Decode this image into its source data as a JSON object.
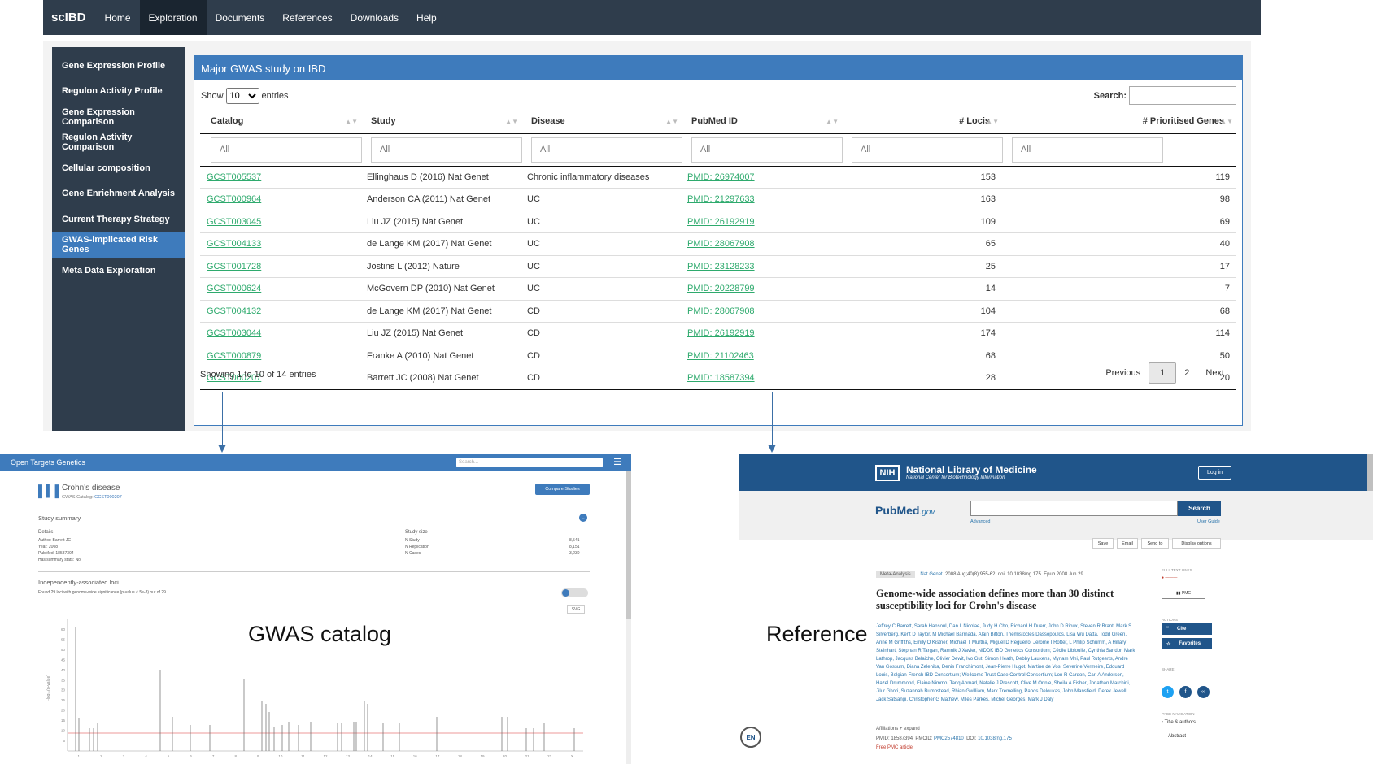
{
  "navbar": {
    "brand": "scIBD",
    "items": [
      "Home",
      "Exploration",
      "Documents",
      "References",
      "Downloads",
      "Help"
    ],
    "active": "Exploration"
  },
  "sidebar": {
    "items": [
      "Gene Expression Profile",
      "Regulon Activity Profile",
      "Gene Expression Comparison",
      "Regulon Activity Comparison",
      "Cellular composition",
      "Gene Enrichment Analysis",
      "Current Therapy Strategy",
      "GWAS-implicated Risk Genes",
      "Meta Data Exploration"
    ],
    "active": "GWAS-implicated Risk Genes"
  },
  "panel": {
    "title": "Major GWAS study on IBD",
    "show_label": "Show",
    "show_value": "10",
    "entries_label": "entries",
    "search_label": "Search:",
    "filter_placeholder": "All",
    "columns": [
      "Catalog",
      "Study",
      "Disease",
      "PubMed ID",
      "# Locis",
      "# Prioritised Genes"
    ],
    "rows": [
      [
        "GCST005537",
        "Ellinghaus D (2016) Nat Genet",
        "Chronic inflammatory diseases",
        "PMID: 26974007",
        "153",
        "119"
      ],
      [
        "GCST000964",
        "Anderson CA (2011) Nat Genet",
        "UC",
        "PMID: 21297633",
        "163",
        "98"
      ],
      [
        "GCST003045",
        "Liu JZ (2015) Nat Genet",
        "UC",
        "PMID: 26192919",
        "109",
        "69"
      ],
      [
        "GCST004133",
        "de Lange KM (2017) Nat Genet",
        "UC",
        "PMID: 28067908",
        "65",
        "40"
      ],
      [
        "GCST001728",
        "Jostins L (2012) Nature",
        "UC",
        "PMID: 23128233",
        "25",
        "17"
      ],
      [
        "GCST000624",
        "McGovern DP (2010) Nat Genet",
        "UC",
        "PMID: 20228799",
        "14",
        "7"
      ],
      [
        "GCST004132",
        "de Lange KM (2017) Nat Genet",
        "CD",
        "PMID: 28067908",
        "104",
        "68"
      ],
      [
        "GCST003044",
        "Liu JZ (2015) Nat Genet",
        "CD",
        "PMID: 26192919",
        "174",
        "114"
      ],
      [
        "GCST000879",
        "Franke A (2010) Nat Genet",
        "CD",
        "PMID: 21102463",
        "68",
        "50"
      ],
      [
        "GCST000207",
        "Barrett JC (2008) Nat Genet",
        "CD",
        "PMID: 18587394",
        "28",
        "20"
      ]
    ],
    "info": "Showing 1 to 10 of 14 entries",
    "pagination": {
      "previous": "Previous",
      "pages": [
        "1",
        "2"
      ],
      "current": "1",
      "next": "Next"
    }
  },
  "gwas_shot": {
    "header": "Open Targets Genetics",
    "search_placeholder": "Search...",
    "title": "Crohn's disease",
    "catalog_label": "GWAS Catalog:",
    "catalog_id": "GCST000207",
    "compare_button": "Compare Studies",
    "study_summary": "Study summary",
    "details_label": "Details",
    "author": "Author: Barrett JC",
    "year": "Year: 2008",
    "pubmed": "PubMed: 18587394",
    "has_summary": "Has summary stats: No",
    "study_size_label": "Study size",
    "sizes": [
      [
        "N Study",
        "8,541"
      ],
      [
        "N Replication",
        "8,151"
      ],
      [
        "N Cases",
        "3,230"
      ]
    ],
    "loci_title": "Independently-associated loci",
    "loci_text": "Found 29 loci with genome-wide significance (p-value < 5e-8) out of 29",
    "svg_button": "SVG",
    "y_label": "-log₁₀(p-value)",
    "y_ticks": [
      "5",
      "10",
      "15",
      "20",
      "25",
      "30",
      "35",
      "40",
      "45",
      "50",
      "55",
      "60"
    ],
    "x_ticks": [
      "1",
      "2",
      "3",
      "4",
      "5",
      "6",
      "7",
      "8",
      "9",
      "10",
      "11",
      "12",
      "13",
      "14",
      "15",
      "16",
      "17",
      "18",
      "19",
      "20",
      "21",
      "22",
      "X"
    ],
    "caption": "GWAS catalog"
  },
  "pubmed_shot": {
    "nih": "NIH",
    "nlm": "National Library of Medicine",
    "ncbi": "National Center for Biotechnology Information",
    "login": "Log in",
    "logo": "PubMed",
    "logo_suffix": ".gov",
    "search_button": "Search",
    "advanced": "Advanced",
    "user_guide": "User Guide",
    "tools": [
      "Save",
      "Email",
      "Send to",
      "Display options"
    ],
    "tag": "Meta-Analysis",
    "journal": "Nat Genet",
    "citation": ". 2008 Aug;40(8):955-62. doi: 10.1038/ng.175. Epub 2008 Jun 29.",
    "article_title": "Genome-wide association defines more than 30 distinct susceptibility loci for Crohn's disease",
    "authors": "Jeffrey C Barrett, Sarah Hansoul, Dan L Nicolae, Judy H Cho, Richard H Duerr, John D Rioux, Steven R Brant, Mark S Silverberg, Kent D Taylor, M Michael Barmada, Alain Bitton, Themistocles Dassopoulos, Lisa Wu Datta, Todd Green, Anne M Griffiths, Emily O Kistner, Michael T Murtha, Miguel D Regueiro, Jerome I Rotter, L Philip Schumm, A Hillary Steinhart, Stephan R Targan, Ramnik J Xavier, NIDDK IBD Genetics Consortium; Cécile Libioulle, Cynthia Sandor, Mark Lathrop, Jacques Belaiche, Olivier Dewit, Ivo Gut, Simon Heath, Debby Laukens, Myriam Mni, Paul Rutgeerts, André Van Gossum, Diana Zelenika, Denis Franchimont, Jean-Pierre Hugot, Martine de Vos, Severine Vermeire, Edouard Louis, Belgian-French IBD Consortium; Wellcome Trust Case Control Consortium; Lon R Cardon, Carl A Anderson, Hazel Drummond, Elaine Nimmo, Tariq Ahmad, Natalie J Prescott, Clive M Onnie, Sheila A Fisher, Jonathan Marchini, Jilur Ghori, Suzannah Bumpstead, Rhian Gwilliam, Mark Tremelling, Panos Deloukas, John Mansfield, Derek Jewell, Jack Satsangi, Christopher G Mathew, Miles Parkes, Michel Georges, Mark J Daly",
    "affiliations": "Affiliations + expand",
    "pmid": "PMID: 18587394",
    "pmcid_label": "PMCID:",
    "pmcid": "PMC2574810",
    "doi_label": "DOI:",
    "doi": "10.1038/ng.175",
    "free": "Free PMC article",
    "full_text_links": "FULL TEXT LINKS",
    "actions": "ACTIONS",
    "cite": "Cite",
    "favorites": "Favorites",
    "share": "SHARE",
    "page_nav": "PAGE NAVIGATION",
    "nav_items": [
      "Title & authors",
      "Abstract"
    ],
    "en": "EN",
    "caption": "Reference"
  },
  "colors": {
    "nav_bg": "#2f3d4c",
    "accent": "#3e7bbc",
    "link_green": "#2eaa6d",
    "pubmed_blue": "#20558a"
  }
}
